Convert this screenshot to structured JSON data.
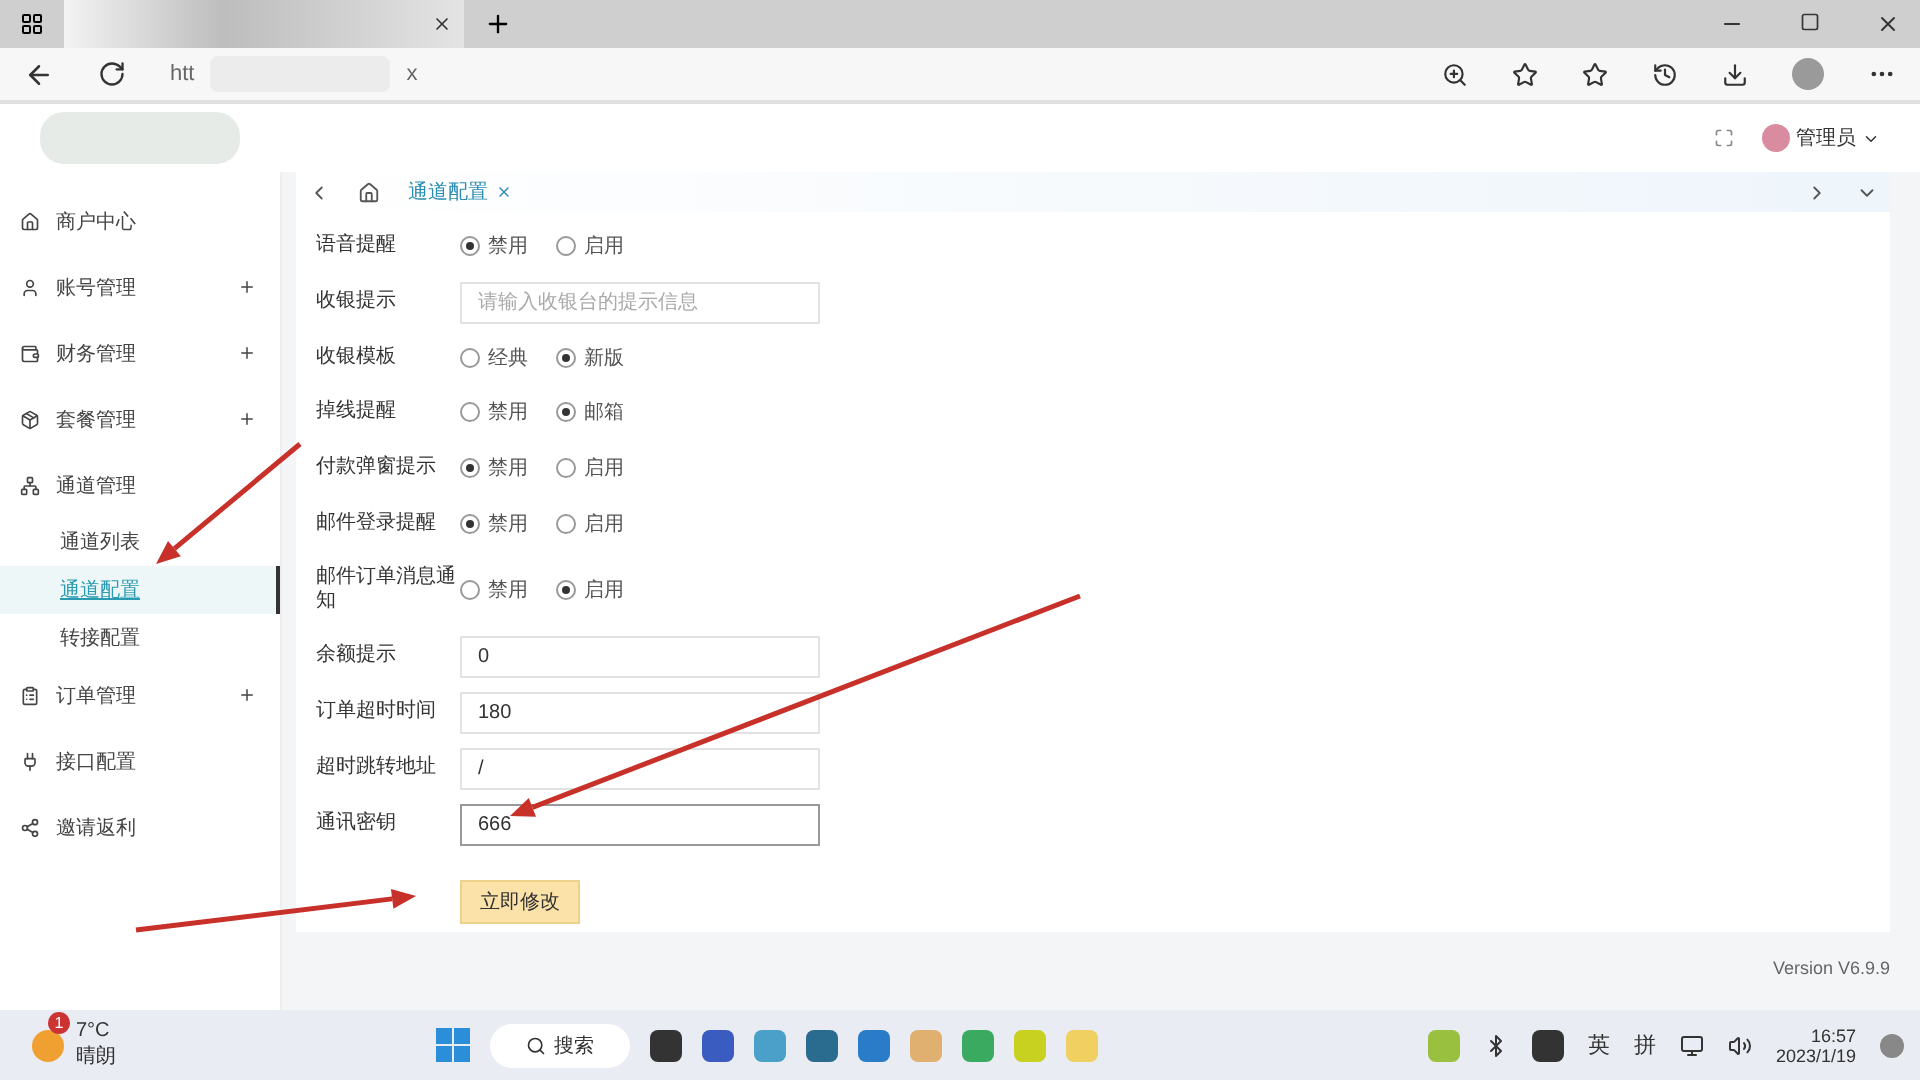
{
  "browser": {
    "url_parts": [
      "htt",
      "x"
    ]
  },
  "header": {
    "user": "管理员"
  },
  "sidebar": {
    "items": [
      {
        "label": "商户中心",
        "expandable": false
      },
      {
        "label": "账号管理",
        "expandable": true
      },
      {
        "label": "财务管理",
        "expandable": true
      },
      {
        "label": "套餐管理",
        "expandable": true
      },
      {
        "label": "通道管理",
        "expandable": false,
        "children": [
          {
            "label": "通道列表",
            "selected": false
          },
          {
            "label": "通道配置",
            "selected": true
          },
          {
            "label": "转接配置",
            "selected": false
          }
        ]
      },
      {
        "label": "订单管理",
        "expandable": true
      },
      {
        "label": "接口配置",
        "expandable": false
      },
      {
        "label": "邀请返利",
        "expandable": false
      }
    ]
  },
  "page_tabs": [
    {
      "label": "通道配置",
      "selected": true
    }
  ],
  "form": {
    "rows": [
      {
        "kind": "radio",
        "label": "语音提醒",
        "options": [
          {
            "label": "禁用",
            "selected": true
          },
          {
            "label": "启用",
            "selected": false
          }
        ]
      },
      {
        "kind": "input",
        "label": "收银提示",
        "placeholder": "请输入收银台的提示信息",
        "focused": false
      },
      {
        "kind": "radio",
        "label": "收银模板",
        "options": [
          {
            "label": "经典",
            "selected": false
          },
          {
            "label": "新版",
            "selected": true
          }
        ]
      },
      {
        "kind": "radio",
        "label": "掉线提醒",
        "options": [
          {
            "label": "禁用",
            "selected": false
          },
          {
            "label": "邮箱",
            "selected": true
          }
        ]
      },
      {
        "kind": "radio",
        "label": "付款弹窗提示",
        "options": [
          {
            "label": "禁用",
            "selected": true
          },
          {
            "label": "启用",
            "selected": false
          }
        ]
      },
      {
        "kind": "radio",
        "label": "邮件登录提醒",
        "options": [
          {
            "label": "禁用",
            "selected": true
          },
          {
            "label": "启用",
            "selected": false
          }
        ]
      },
      {
        "kind": "radio",
        "label": "邮件订单消息通知",
        "options": [
          {
            "label": "禁用",
            "selected": false
          },
          {
            "label": "启用",
            "selected": true
          }
        ]
      },
      {
        "kind": "input",
        "label": "余额提示",
        "value": "0",
        "focused": false
      },
      {
        "kind": "input",
        "label": "订单超时时间",
        "value": "180",
        "focused": false
      },
      {
        "kind": "input",
        "label": "超时跳转地址",
        "value": "/",
        "focused": false
      },
      {
        "kind": "input",
        "label": "通讯密钥",
        "value": "666",
        "focused": true
      }
    ],
    "submit": "立即修改"
  },
  "version": "Version V6.9.9",
  "taskbar": {
    "temperature": "7°C",
    "weather": "晴朗",
    "weather_badge": "1",
    "search": "搜索",
    "ime": [
      "英",
      "拼"
    ],
    "time": "16:57",
    "date": "2023/1/19"
  }
}
